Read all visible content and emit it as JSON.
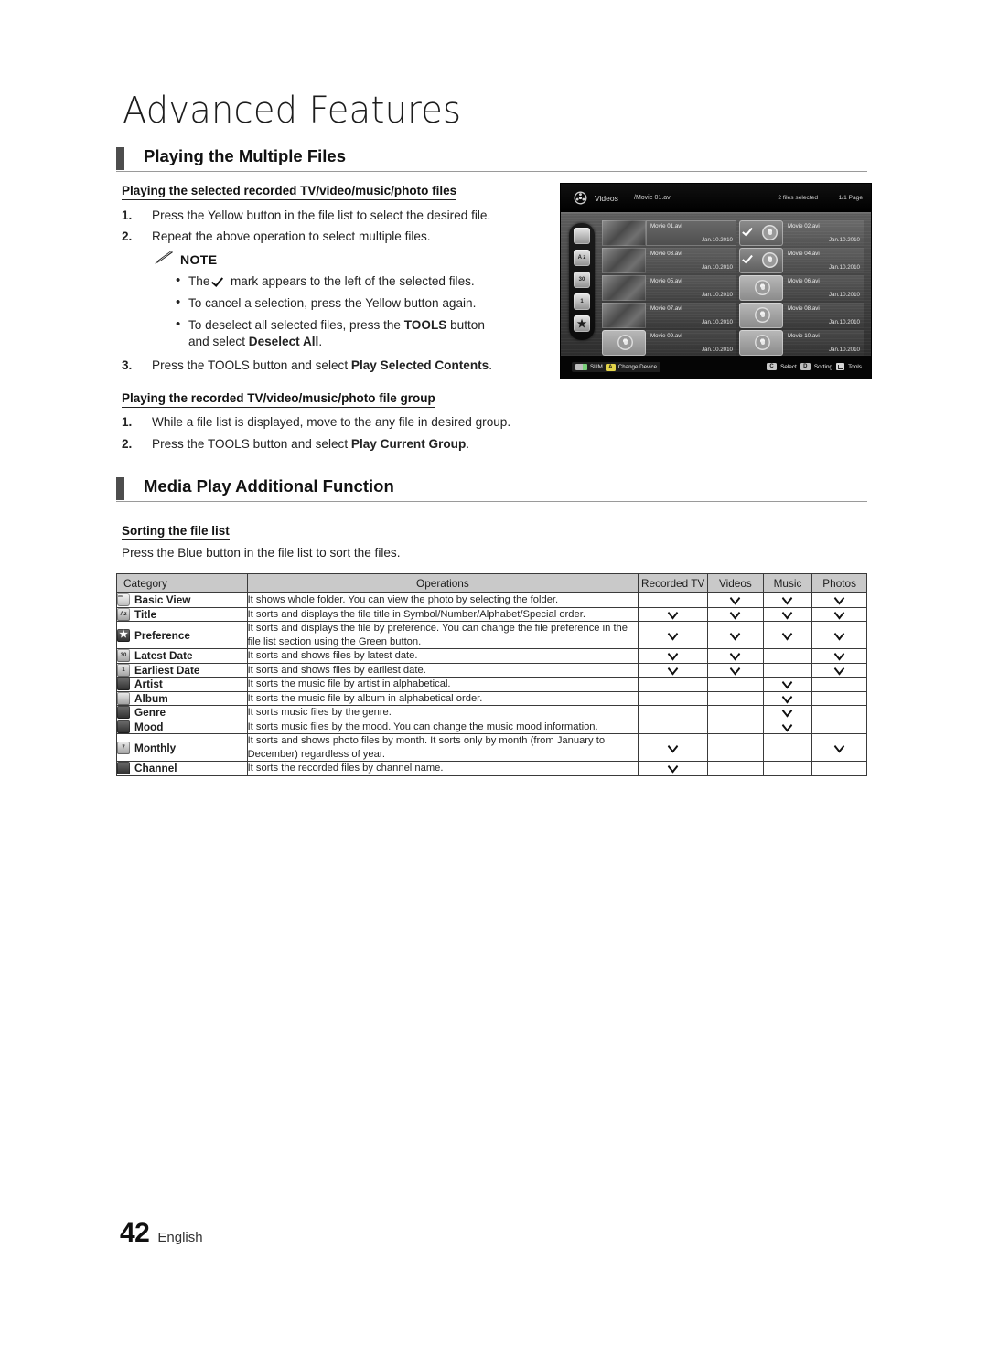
{
  "chapter": {
    "title": "Advanced Features"
  },
  "sections": [
    {
      "id": "playing-multiple-files",
      "title": "Playing the Multiple Files"
    },
    {
      "id": "media-play-additional",
      "title": "Media Play Additional Function"
    }
  ],
  "sub_sections": {
    "selected_files": {
      "heading": "Playing the selected recorded TV/video/music/photo files",
      "steps": [
        {
          "num": "1.",
          "text": "Press the Yellow button in the file list to select the desired file."
        },
        {
          "num": "2.",
          "text": "Repeat the above operation to select multiple files."
        },
        {
          "num": "3.",
          "text": "Press the TOOLS button and select Play Selected Contents."
        }
      ],
      "step3_prefix": "Press the ",
      "step3_tools": "TOOLS",
      "step3_mid": " button and select ",
      "step3_bold": "Play Selected Contents",
      "step3_suffix": ".",
      "note_label": "NOTE",
      "note_items": [
        {
          "prefix": "The ",
          "suffix": " mark appears to the left of the selected files.",
          "has_check": true
        },
        {
          "prefix": "To cancel a selection, press the Yellow button again.",
          "suffix": "",
          "has_check": false
        },
        {
          "prefix": "To deselect all selected files, press the ",
          "bold1": "TOOLS",
          "mid": " button",
          "line2_prefix": "and select ",
          "bold2": "Deselect All",
          "line2_suffix": ".",
          "has_check": false
        }
      ]
    },
    "file_group": {
      "heading": "Playing the recorded TV/video/music/photo file group",
      "steps": [
        {
          "num": "1.",
          "text": "While a file list is displayed, move to the any file in desired group."
        },
        {
          "num": "2.",
          "text": "Press the TOOLS button and select Play Current Group."
        }
      ],
      "step2_prefix": "Press the ",
      "step2_tools": "TOOLS",
      "step2_mid": " button and select ",
      "step2_bold": "Play Current Group",
      "step2_suffix": "."
    },
    "sorting": {
      "heading": "Sorting the file list",
      "paragraph": "Press the Blue button in the file list to sort the files."
    }
  },
  "tv_screen": {
    "header": {
      "app_title": "Videos",
      "path": "/Movie 01.avi",
      "selected_count": "2 files selected",
      "page": "1/1 Page"
    },
    "sidebar_icons": [
      "folder-icon",
      "title-sort-icon",
      "latest-date-icon",
      "earliest-date-icon",
      "preference-star-icon"
    ],
    "sidebar_labels": [
      "",
      "A z",
      "30",
      "1",
      ""
    ],
    "files": [
      {
        "name": "Movie 01.avi",
        "date": "Jan.10.2010",
        "side": "left",
        "highlighted": true,
        "checked": false
      },
      {
        "name": "Movie 02.avi",
        "date": "Jan.10.2010",
        "side": "right",
        "highlighted": false,
        "checked": true
      },
      {
        "name": "Movie 03.avi",
        "date": "Jan.10.2010",
        "side": "left",
        "highlighted": false,
        "checked": false
      },
      {
        "name": "Movie 04.avi",
        "date": "Jan.10.2010",
        "side": "right",
        "highlighted": false,
        "checked": true
      },
      {
        "name": "Movie 05.avi",
        "date": "Jan.10.2010",
        "side": "left",
        "highlighted": false,
        "checked": false
      },
      {
        "name": "Movie 06.avi",
        "date": "Jan.10.2010",
        "side": "right",
        "highlighted": false,
        "checked": false
      },
      {
        "name": "Movie 07.avi",
        "date": "Jan.10.2010",
        "side": "left",
        "highlighted": false,
        "checked": false
      },
      {
        "name": "Movie 08.avi",
        "date": "Jan.10.2010",
        "side": "right",
        "highlighted": false,
        "checked": false
      },
      {
        "name": "Movie 09.avi",
        "date": "Jan.10.2010",
        "side": "left",
        "highlighted": false,
        "checked": false
      },
      {
        "name": "Movie 10.avi",
        "date": "Jan.10.2010",
        "side": "right",
        "highlighted": false,
        "checked": false
      }
    ],
    "footer": {
      "device_label": "SUM",
      "change_device_key": "A",
      "change_device_label": "Change Device",
      "select_key": "C",
      "select_label": "Select",
      "sorting_key": "D",
      "sorting_label": "Sorting",
      "tools_label": "Tools"
    }
  },
  "table": {
    "headers": [
      "Category",
      "Operations",
      "Recorded TV",
      "Videos",
      "Music",
      "Photos"
    ],
    "rows": [
      {
        "icon": "folder-icon",
        "icon_text": "",
        "category": "Basic View",
        "operations": "It shows whole folder. You can view the photo by selecting the folder.",
        "recorded_tv": false,
        "videos": true,
        "music": true,
        "photos": true
      },
      {
        "icon": "title-icon",
        "icon_text": "Az",
        "category": "Title",
        "operations": "It sorts and displays the file title in Symbol/Number/Alphabet/Special order.",
        "recorded_tv": true,
        "videos": true,
        "music": true,
        "photos": true
      },
      {
        "icon": "star-icon",
        "icon_text": "",
        "category": "Preference",
        "operations": "It sorts and displays the file by preference. You can change the file preference in the file list section using the Green button.",
        "recorded_tv": true,
        "videos": true,
        "music": true,
        "photos": true
      },
      {
        "icon": "calendar-icon",
        "icon_text": "30",
        "category": "Latest Date",
        "operations": "It sorts and shows files by latest date.",
        "recorded_tv": true,
        "videos": true,
        "music": false,
        "photos": true
      },
      {
        "icon": "calendar-icon",
        "icon_text": "1",
        "category": "Earliest Date",
        "operations": "It sorts and shows files by earliest date.",
        "recorded_tv": true,
        "videos": true,
        "music": false,
        "photos": true
      },
      {
        "icon": "artist-icon",
        "icon_text": "",
        "category": "Artist",
        "operations": "It sorts the music file by artist in alphabetical.",
        "recorded_tv": false,
        "videos": false,
        "music": true,
        "photos": false
      },
      {
        "icon": "album-icon",
        "icon_text": "",
        "category": "Album",
        "operations": "It sorts the music file by album in alphabetical order.",
        "recorded_tv": false,
        "videos": false,
        "music": true,
        "photos": false
      },
      {
        "icon": "genre-icon",
        "icon_text": "",
        "category": "Genre",
        "operations": "It sorts music files by the genre.",
        "recorded_tv": false,
        "videos": false,
        "music": true,
        "photos": false
      },
      {
        "icon": "mood-icon",
        "icon_text": "",
        "category": "Mood",
        "operations": "It sorts music files by the mood. You can change the music mood information.",
        "recorded_tv": false,
        "videos": false,
        "music": true,
        "photos": false
      },
      {
        "icon": "monthly-icon",
        "icon_text": "7",
        "category": "Monthly",
        "operations": "It sorts and shows photo files by month. It sorts only by month (from January to December) regardless of year.",
        "recorded_tv": true,
        "videos": false,
        "music": false,
        "photos": true
      },
      {
        "icon": "channel-icon",
        "icon_text": "",
        "category": "Channel",
        "operations": "It sorts the recorded files by channel name.",
        "recorded_tv": true,
        "videos": false,
        "music": false,
        "photos": false
      }
    ]
  },
  "footer": {
    "page_number": "42",
    "language": "English"
  }
}
